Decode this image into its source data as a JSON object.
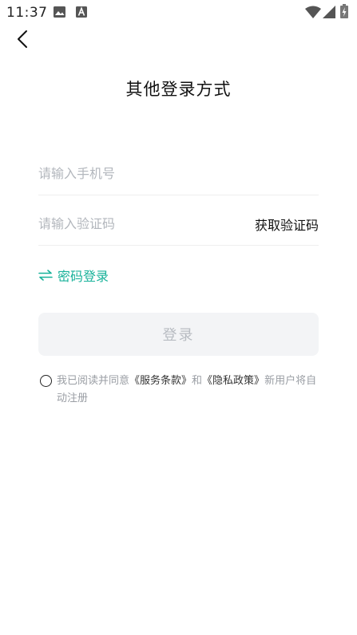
{
  "status_bar": {
    "time": "11:37"
  },
  "header": {
    "title": "其他登录方式"
  },
  "form": {
    "phone_placeholder": "请输入手机号",
    "code_placeholder": "请输入验证码",
    "get_code_label": "获取验证码",
    "switch_label": "密码登录",
    "login_label": "登录"
  },
  "agreement": {
    "prefix": "我已阅读并同意",
    "service_link": "《服务条款》",
    "and": "和",
    "privacy_link": "《隐私政策》",
    "suffix": "新用户将自动注册"
  },
  "colors": {
    "accent": "#18b29a",
    "button_bg": "#f3f4f6",
    "placeholder": "#b3b7bd"
  }
}
